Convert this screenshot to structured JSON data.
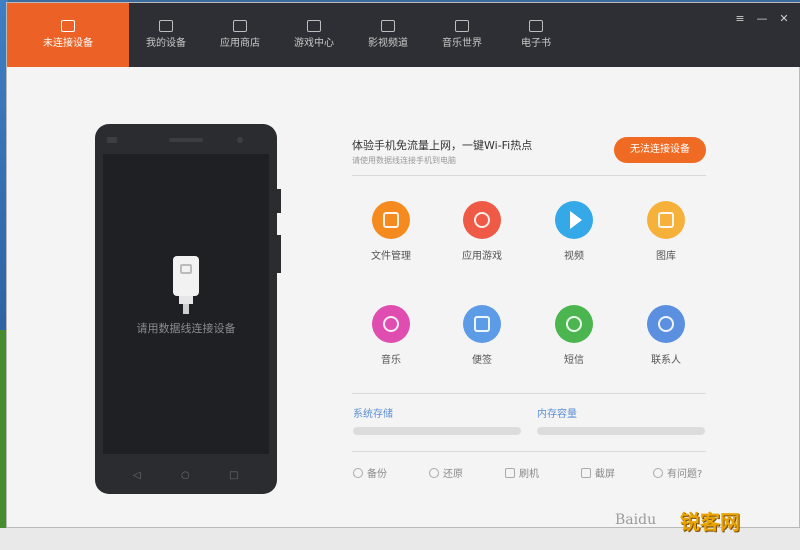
{
  "nav_tabs": [
    {
      "label": "未连接设备",
      "icon": "phone-icon",
      "active": true
    },
    {
      "label": "我的设备",
      "icon": "device-icon"
    },
    {
      "label": "应用商店",
      "icon": "bag-icon"
    },
    {
      "label": "游戏中心",
      "icon": "gamepad-icon"
    },
    {
      "label": "影视频道",
      "icon": "tv-icon"
    },
    {
      "label": "音乐世界",
      "icon": "music-icon"
    },
    {
      "label": "电子书",
      "icon": "book-icon"
    }
  ],
  "window_controls": [
    "≡",
    "—",
    "✕"
  ],
  "phone": {
    "screen_message": "请用数据线连接设备",
    "nav_buttons": [
      "◁",
      "○",
      "□"
    ]
  },
  "connect_tip": {
    "title": "体验手机免流量上网，一键Wi-Fi热点",
    "subtitle": "请使用数据线连接手机到电脑",
    "button": "无法连接设备"
  },
  "features": [
    {
      "label": "文件管理",
      "color": "#f58a1f",
      "icon": "folder-icon"
    },
    {
      "label": "应用游戏",
      "color": "#ee5a45",
      "icon": "apps-icon"
    },
    {
      "label": "视频",
      "color": "#35a8e8",
      "icon": "play-icon"
    },
    {
      "label": "图库",
      "color": "#f6b13b",
      "icon": "picture-icon"
    },
    {
      "label": "音乐",
      "color": "#e04db0",
      "icon": "music-icon"
    },
    {
      "label": "便签",
      "color": "#5c9be6",
      "icon": "note-icon"
    },
    {
      "label": "短信",
      "color": "#4bb54f",
      "icon": "message-icon"
    },
    {
      "label": "联系人",
      "color": "#5b8fe0",
      "icon": "contact-icon"
    }
  ],
  "storage": {
    "system_label": "系统存储",
    "internal_label": "内存容量"
  },
  "bottom_actions": [
    {
      "label": "备份",
      "icon": "backup-icon"
    },
    {
      "label": "还原",
      "icon": "restore-icon"
    },
    {
      "label": "刷机",
      "icon": "flash-icon"
    },
    {
      "label": "截屏",
      "icon": "screenshot-icon"
    },
    {
      "label": "有问题?",
      "icon": "help-icon"
    }
  ],
  "watermarks": {
    "baidu": "Baidu",
    "site": "锐客网"
  }
}
